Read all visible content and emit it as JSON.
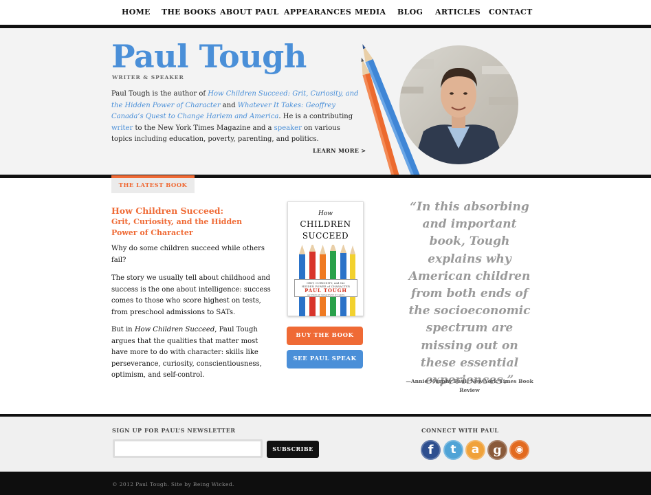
{
  "nav": {
    "items": [
      {
        "label": "HOME"
      },
      {
        "label": "THE BOOKS"
      },
      {
        "label": "ABOUT PAUL"
      },
      {
        "label": "APPEARANCES"
      },
      {
        "label": "MEDIA"
      },
      {
        "label": "BLOG"
      },
      {
        "label": "ARTICLES"
      },
      {
        "label": "CONTACT"
      }
    ]
  },
  "hero": {
    "title": "Paul Tough",
    "subtitle": "WRITER & SPEAKER",
    "bio": {
      "t1": "Paul Tough is the author of ",
      "book1": "How Children Succeed: Grit, Curiosity, and the Hidden Power of Character",
      "t2": " and ",
      "book2": "Whatever It Takes: Geoffrey Canada’s Quest to Change Harlem and America",
      "t3": ". He is a contributing ",
      "writer": "writer",
      "t4": " to the New York Times Magazine and a ",
      "speaker": "speaker",
      "t5": " on various topics including education, poverty, parenting, and politics."
    },
    "learn_more": "LEARN MORE >"
  },
  "latest": {
    "tab_label": "THE LATEST BOOK",
    "book_title": "How Children Succeed:",
    "book_subtitle": "Grit, Curiosity, and the Hidden Power of Character",
    "p1": "Why do some children succeed while others fail?",
    "p2": "The story we usually tell about childhood and success is the one about intelligence: success comes to those who score highest on tests, from preschool admissions to SATs.",
    "p3_a": "But in ",
    "p3_italic": "How Children Succeed",
    "p3_b": ", Paul Tough argues that the qualities that matter most have more to do with character: skills like perseverance, curiosity, conscientiousness, optimism, and self-control.",
    "cover": {
      "how": "How",
      "line1": "CHILDREN",
      "line2": "SUCCEED",
      "small_1": "GRIT, CURIOSITY, and the",
      "small_2": "HIDDEN POWER of CHARACTER",
      "author": "PAUL TOUGH",
      "tiny": "AUTHOR OF WHATEVER IT TAKES"
    },
    "buy_label": "BUY THE BOOK",
    "speak_label": "SEE PAUL SPEAK"
  },
  "quote": {
    "text": "“In this absorbing and important book, Tough explains why American children from both ends of the socioeconomic spectrum are missing out on these essential experiences.”",
    "attribution": "—Annie Murphy Paul, New York Times Book Review"
  },
  "footer": {
    "newsletter_label": "SIGN UP FOR PAUL’S NEWSLETTER",
    "newsletter_value": "",
    "subscribe_label": "SUBSCRIBE",
    "connect_label": "CONNECT WITH PAUL",
    "social": [
      {
        "icon": "facebook-icon",
        "glyph": "f",
        "color": "#2e4f8f"
      },
      {
        "icon": "twitter-icon",
        "glyph": "t",
        "color": "#4fa3d6"
      },
      {
        "icon": "amazon-icon",
        "glyph": "a",
        "color": "#f0a23a"
      },
      {
        "icon": "goodreads-icon",
        "glyph": "g",
        "color": "#8a5a3a"
      },
      {
        "icon": "rss-icon",
        "glyph": "◉",
        "color": "#e26a1f"
      }
    ],
    "copyright": "© 2012 Paul Tough. Site by Being Wicked."
  },
  "colors": {
    "accent_blue": "#4a8fd8",
    "accent_orange": "#ef6a35"
  }
}
